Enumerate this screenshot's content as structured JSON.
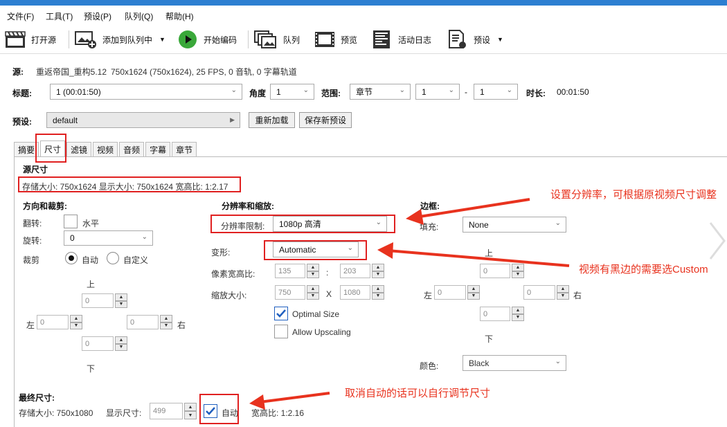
{
  "menu": [
    "文件(F)",
    "工具(T)",
    "预设(P)",
    "队列(Q)",
    "帮助(H)"
  ],
  "toolbar": {
    "open": "打开源",
    "add_queue": "添加到队列中",
    "start": "开始编码",
    "queue": "队列",
    "preview": "预览",
    "log": "活动日志",
    "presets": "预设"
  },
  "source": {
    "label": "源:",
    "name": "重返帝国_重构5.12",
    "info": "750x1624 (750x1624), 25 FPS, 0 音轨, 0 字幕轨道"
  },
  "title_row": {
    "title_label": "标题:",
    "title_value": "1 (00:01:50)",
    "angle_label": "角度",
    "angle_value": "1",
    "range_label": "范围:",
    "range_type": "章节",
    "range_from": "1",
    "dash": "-",
    "range_to": "1",
    "duration_label": "时长:",
    "duration_value": "00:01:50"
  },
  "preset_row": {
    "label": "预设:",
    "value": "default",
    "reload": "重新加载",
    "save_new": "保存新预设"
  },
  "tabs": [
    "摘要",
    "尺寸",
    "滤镜",
    "视频",
    "音频",
    "字幕",
    "章节"
  ],
  "dimensions": {
    "source_title": "源尺寸",
    "source_info": "存储大小: 750x1624 显示大小: 750x1624 宽高比: 1:2.17",
    "orient_title": "方向和裁剪:",
    "flip_label": "翻转:",
    "flip_text": "水平",
    "rotate_label": "旋转:",
    "rotate_value": "0",
    "crop_label": "裁剪",
    "crop_auto": "自动",
    "crop_custom": "自定义",
    "crop_top_label": "上",
    "crop_top": "0",
    "crop_left_label": "左",
    "crop_left": "0",
    "crop_right": "0",
    "crop_right_label": "右",
    "crop_bottom": "0",
    "crop_bottom_label": "下",
    "res_title": "分辨率和缩放:",
    "res_limit_label": "分辨率限制:",
    "res_limit_value": "1080p 高清",
    "anamorphic_label": "变形:",
    "anamorphic_value": "Automatic",
    "par_label": "像素宽高比:",
    "par_w": "135",
    "par_colon": ":",
    "par_h": "203",
    "scale_label": "缩放大小:",
    "scale_w": "750",
    "scale_x": "X",
    "scale_h": "1080",
    "optimal": "Optimal Size",
    "upscaling": "Allow Upscaling",
    "border_title": "边框:",
    "fill_label": "填充:",
    "fill_value": "None",
    "border_top_label": "上",
    "border_top": "0",
    "border_left_label": "左",
    "border_left": "0",
    "border_right": "0",
    "border_right_label": "右",
    "border_bottom": "0",
    "border_bottom_label": "下",
    "color_label": "颜色:",
    "color_value": "Black",
    "final_title": "最终尺寸:",
    "final_storage": "存储大小: 750x1080",
    "final_display_label": "显示尺寸:",
    "final_display": "499",
    "final_auto": "自动",
    "final_ratio": "宽高比: 1:2.16"
  },
  "annotations": {
    "a1": "设置分辨率，可根据原视频尺寸调整",
    "a2": "视频有黑边的需要选Custom",
    "a3": "取消自动的话可以自行调节尺寸"
  },
  "colors": {
    "annotation": "#e8321e",
    "accent": "#1f5fbf",
    "play": "#3aa83a"
  }
}
